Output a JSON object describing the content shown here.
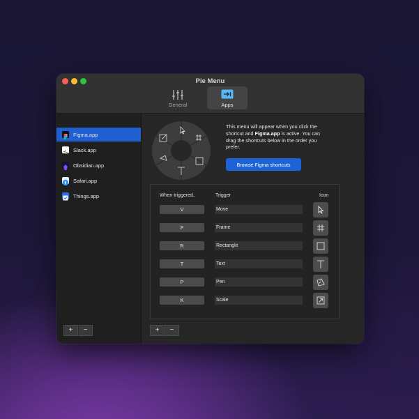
{
  "window": {
    "title": "Pie Menu",
    "tabs": [
      {
        "label": "General",
        "icon": "sliders-icon"
      },
      {
        "label": "Apps",
        "icon": "arrow-right-to-bar-icon",
        "selected": true
      }
    ]
  },
  "sidebar": {
    "apps": [
      {
        "label": "Figma.app",
        "icon": "figma-icon",
        "selected": true
      },
      {
        "label": "Slack.app",
        "icon": "slack-icon"
      },
      {
        "label": "Obsidian.app",
        "icon": "obsidian-icon"
      },
      {
        "label": "Safari.app",
        "icon": "safari-icon"
      },
      {
        "label": "Things.app",
        "icon": "things-icon"
      }
    ],
    "add_label": "+",
    "remove_label": "−"
  },
  "main": {
    "desc_1": "This menu will appear when you click the shortcut and ",
    "desc_app": "Figma.app",
    "desc_2": " is active. You can drag the shortcuts below in the order you prefer.",
    "browse_label": "Browse Figma shortcuts",
    "table": {
      "header_key": "When triggered..",
      "header_trigger": "Trigger",
      "header_icon": "Icon",
      "rows": [
        {
          "key": "V",
          "trigger": "Move",
          "icon": "pointer-icon"
        },
        {
          "key": "F",
          "trigger": "Frame",
          "icon": "frame-icon"
        },
        {
          "key": "R",
          "trigger": "Rectangle",
          "icon": "rectangle-icon"
        },
        {
          "key": "T",
          "trigger": "Text",
          "icon": "text-icon"
        },
        {
          "key": "P",
          "trigger": "Pen",
          "icon": "pen-icon"
        },
        {
          "key": "K",
          "trigger": "Scale",
          "icon": "scale-icon"
        }
      ]
    },
    "add_label": "+",
    "remove_label": "−"
  },
  "colors": {
    "accent": "#1f5fd0",
    "button_blue": "#1d63d6",
    "window_bg": "#2a2a2a"
  }
}
